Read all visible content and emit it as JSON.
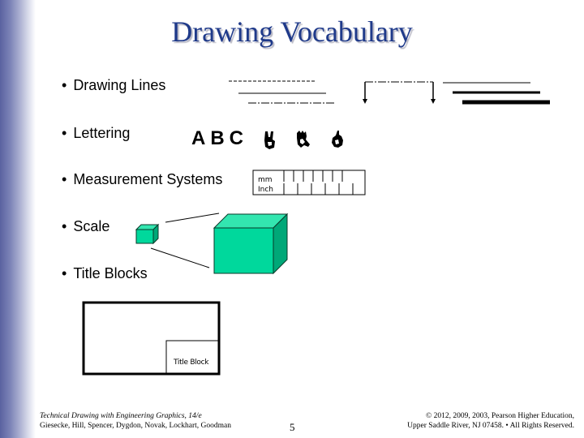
{
  "slide": {
    "title": "Drawing Vocabulary",
    "accent_color": "#1f3a8a",
    "sidebar_gradient_color": "#5a62a0"
  },
  "bullets": [
    {
      "marker": "•",
      "label": "Drawing Lines"
    },
    {
      "marker": "•",
      "label": "Lettering"
    },
    {
      "marker": "•",
      "label": "Measurement Systems"
    },
    {
      "marker": "•",
      "label": "Scale"
    },
    {
      "marker": "•",
      "label": "Title Blocks"
    }
  ],
  "drawing_lines": {
    "samples": [
      "hidden-line",
      "visible-line",
      "center-line",
      "dimension-line-with-arrows",
      "thin-line",
      "medium-line",
      "thick-line"
    ]
  },
  "lettering": {
    "standard_text": "ABC",
    "decorative_glyphs": [
      "hand-sign-a-icon",
      "hand-sign-b-icon",
      "hand-sign-c-icon"
    ]
  },
  "measurement": {
    "units": [
      "mm",
      "Inch"
    ]
  },
  "scale": {
    "cube_color": "#00d89c",
    "cube_top_color": "#33e6b0",
    "cube_side_color": "#00a878"
  },
  "title_block": {
    "label": "Title Block"
  },
  "footer": {
    "book_title": "Technical Drawing with Engineering Graphics, 14/e",
    "authors": "Giesecke, Hill, Spencer, Dygdon, Novak, Lockhart, Goodman",
    "page_number": "5",
    "copyright_line1": "© 2012, 2009, 2003, Pearson Higher Education,",
    "copyright_line2": "Upper Saddle River, NJ 07458. • All Rights Reserved."
  }
}
